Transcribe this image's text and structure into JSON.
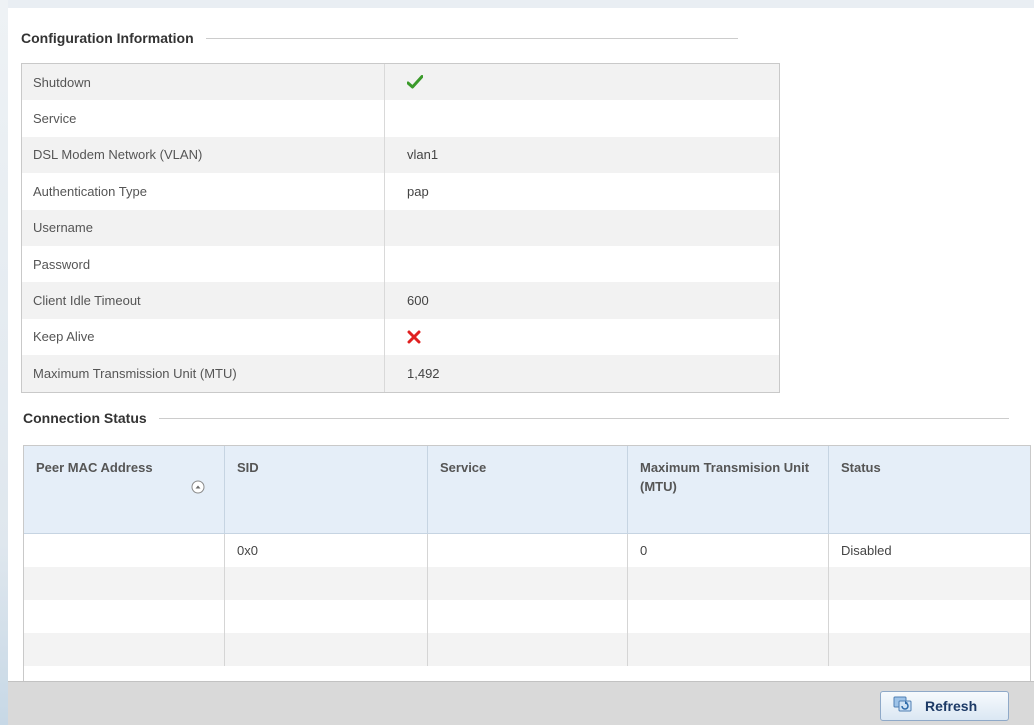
{
  "config": {
    "title": "Configuration Information",
    "rows": [
      {
        "label": "Shutdown",
        "value": "",
        "icon": "check-icon"
      },
      {
        "label": "Service",
        "value": ""
      },
      {
        "label": "DSL Modem Network (VLAN)",
        "value": "vlan1"
      },
      {
        "label": "Authentication Type",
        "value": "pap"
      },
      {
        "label": "Username",
        "value": ""
      },
      {
        "label": "Password",
        "value": ""
      },
      {
        "label": "Client Idle Timeout",
        "value": "600"
      },
      {
        "label": "Keep Alive",
        "value": "",
        "icon": "x-icon"
      },
      {
        "label": "Maximum Transmission Unit (MTU)",
        "value": "1,492"
      }
    ]
  },
  "connection": {
    "title": "Connection Status",
    "columns": [
      "Peer MAC Address",
      "SID",
      "Service",
      "Maximum Transmision Unit (MTU)",
      "Status"
    ],
    "rows": [
      [
        "",
        "0x0",
        "",
        "0",
        "Disabled"
      ],
      [
        "",
        "",
        "",
        "",
        ""
      ],
      [
        "",
        "",
        "",
        "",
        ""
      ],
      [
        "",
        "",
        "",
        "",
        ""
      ]
    ]
  },
  "footer": {
    "refresh_label": "Refresh"
  },
  "colors": {
    "check": "#3a9a2a",
    "x": "#e02020",
    "header_bg": "#e5eef8"
  }
}
